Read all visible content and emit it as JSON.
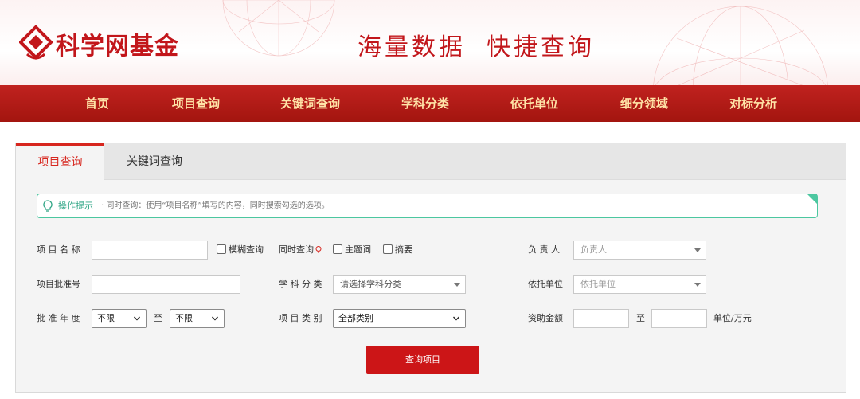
{
  "header": {
    "logo_text": "科学网基金",
    "slogan": [
      "海量数据",
      "快捷查询"
    ]
  },
  "nav": {
    "items": [
      "首页",
      "项目查询",
      "关键词查询",
      "学科分类",
      "依托单位",
      "细分领域",
      "对标分析"
    ]
  },
  "tabs": {
    "active": "项目查询",
    "inactive": "关键词查询"
  },
  "tip": {
    "title": "操作提示",
    "text": "· 同时查询：使用“项目名称”填写的内容，同时搜索勾选的选项。"
  },
  "form": {
    "project_name_label": "项 目 名 称",
    "fuzzy_label": "模糊查询",
    "simultaneous_label": "同时查询",
    "subject_label": "主题词",
    "abstract_label": "摘要",
    "leader_label": "负 责 人",
    "leader_placeholder": "负责人",
    "approval_no_label": "项目批准号",
    "discipline_label": "学 科 分 类",
    "discipline_placeholder": "请选择学科分类",
    "org_label": "依托单位",
    "org_placeholder": "依托单位",
    "year_label": "批 准 年 度",
    "year_from": "不限",
    "to_label": "至",
    "year_to": "不限",
    "category_label": "项 目 类 别",
    "category_value": "全部类别",
    "amount_label": "资助金额",
    "amount_to_label": "至",
    "unit_label": "单位/万元",
    "submit_label": "查询项目"
  },
  "colors": {
    "brand_red": "#c2161b",
    "nav_text": "#ffe4a8",
    "tip_green": "#4cc7a0",
    "button_red": "#cc1517"
  }
}
